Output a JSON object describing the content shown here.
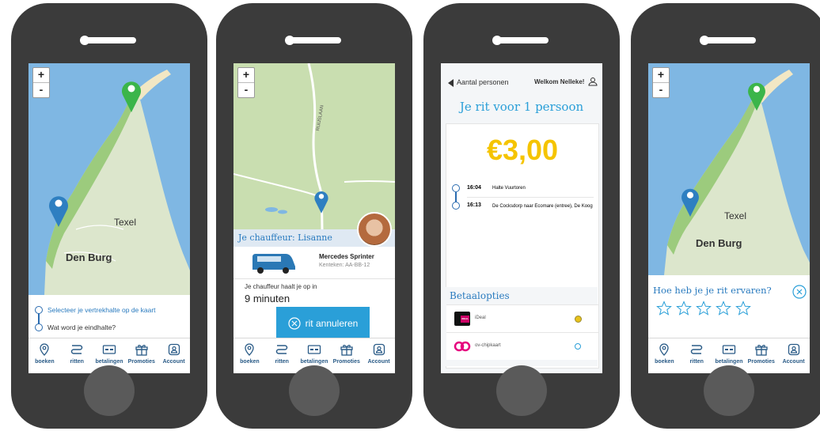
{
  "colors": {
    "accent": "#2a9fd8",
    "brand": "#2a5b87",
    "price": "#f5c400",
    "pin_green": "#3bb54a",
    "pin_blue": "#2e7fc1",
    "map_water": "#7fb7e3",
    "map_land": "#dce6cc"
  },
  "tabs": [
    {
      "label": "boeken",
      "icon": "location-icon"
    },
    {
      "label": "ritten",
      "icon": "route-icon"
    },
    {
      "label": "betalingen",
      "icon": "card-icon"
    },
    {
      "label": "Promoties",
      "icon": "gift-icon"
    },
    {
      "label": "Account",
      "icon": "account-icon"
    }
  ],
  "map": {
    "zoom_in": "+",
    "zoom_out": "-",
    "label_texel": "Texel",
    "label_denburg": "Den Burg"
  },
  "screen1": {
    "departure_prompt": "Selecteer je vertrekhalte op de kaart",
    "destination_prompt": "Wat word je eindhalte?"
  },
  "screen2": {
    "street_name": "RUIJSLAAN",
    "driver_title": "Je chauffeur: Lisanne",
    "vehicle_name": "Mercedes Sprinter",
    "plate": "Kenteken: AA-BB-12",
    "pickup_text": "Je chauffeur haalt je op in",
    "pickup_eta": "9 minuten",
    "cancel_label": "rit annuleren"
  },
  "screen3": {
    "back_label": "Aantal personen",
    "welcome": "Welkom Nelleke!",
    "title": "Je rit voor 1 persoon",
    "price": "€3,00",
    "stops": [
      {
        "time": "16:04",
        "name": "Halte Vuurtoren"
      },
      {
        "time": "16:13",
        "name": "De Cocksdorp naar Ecomare (entree), De Koog"
      }
    ],
    "payment_title": "Betaalopties",
    "payments": [
      {
        "name": "iDeal",
        "logo_text": "iDEAL",
        "selected": true
      },
      {
        "name": "ov-chipkaart",
        "selected": false
      }
    ]
  },
  "screen4": {
    "rating_question": "Hoe heb je je rit ervaren?",
    "stars": 5,
    "rating": 0
  }
}
